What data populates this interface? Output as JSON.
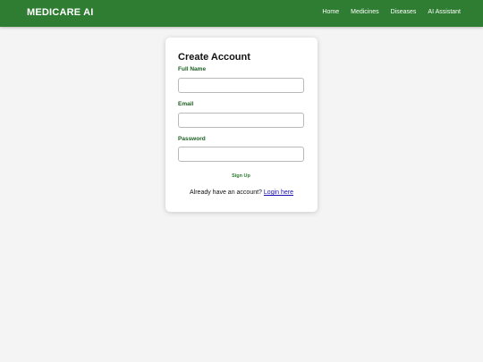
{
  "header": {
    "brand": "MEDICARE AI",
    "nav": [
      "Home",
      "Medicines",
      "Diseases",
      "AI Assistant"
    ]
  },
  "form": {
    "title": "Create Account",
    "fields": [
      {
        "label": "Full Name",
        "value": "",
        "placeholder": ""
      },
      {
        "label": "Email",
        "value": "",
        "placeholder": ""
      },
      {
        "label": "Password",
        "value": "",
        "placeholder": ""
      }
    ],
    "submit_label": "Sign Up",
    "login_prompt": "Already have an account?",
    "login_link": "Login here"
  },
  "colors": {
    "header_bg": "#2e7d32",
    "label": "#1b5e20",
    "link": "#1a0dab",
    "page_bg": "#f4f4f4"
  }
}
